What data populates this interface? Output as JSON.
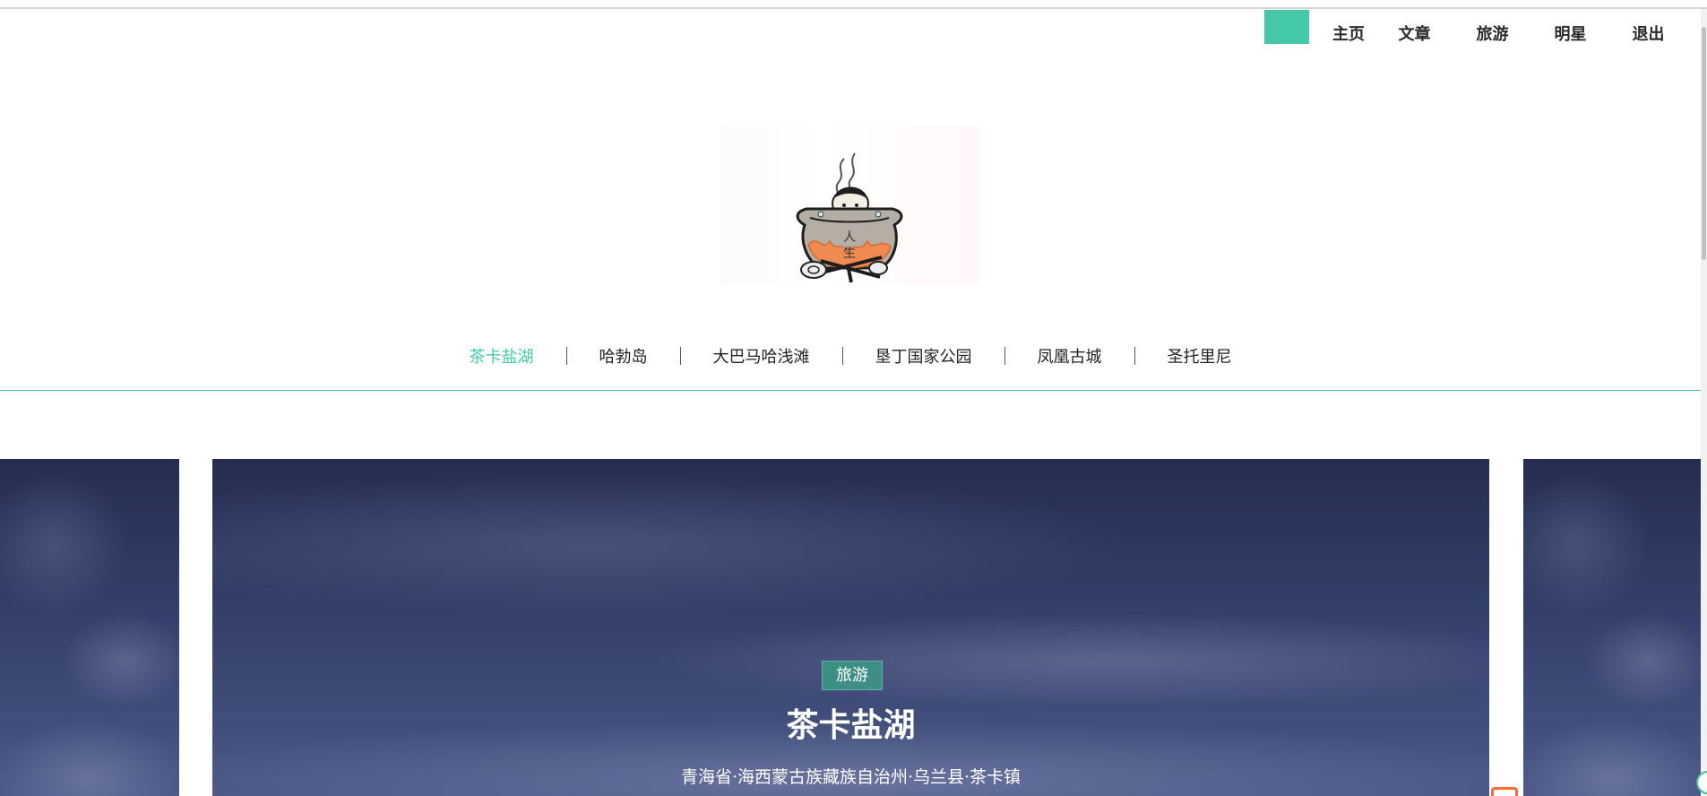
{
  "top_nav": {
    "accent_color": "#45c8a8",
    "items": [
      {
        "label": "主页"
      },
      {
        "label": "文章"
      },
      {
        "label": "旅游"
      },
      {
        "label": "明星"
      },
      {
        "label": "退出"
      }
    ]
  },
  "logo": {
    "icon": "cauldron-logo-icon",
    "logo_text": "人生"
  },
  "category_nav": {
    "active_color": "#45c8a8",
    "items": [
      {
        "label": "茶卡盐湖",
        "active": true
      },
      {
        "label": "哈勃岛",
        "active": false
      },
      {
        "label": "大巴马哈浅滩",
        "active": false
      },
      {
        "label": "垦丁国家公园",
        "active": false
      },
      {
        "label": "凤凰古城",
        "active": false
      },
      {
        "label": "圣托里尼",
        "active": false
      }
    ]
  },
  "carousel": {
    "active_slide": {
      "badge": "旅游",
      "title": "茶卡盐湖",
      "subtitle": "青海省·海西蒙古族藏族自治州·乌兰县·茶卡镇"
    }
  }
}
